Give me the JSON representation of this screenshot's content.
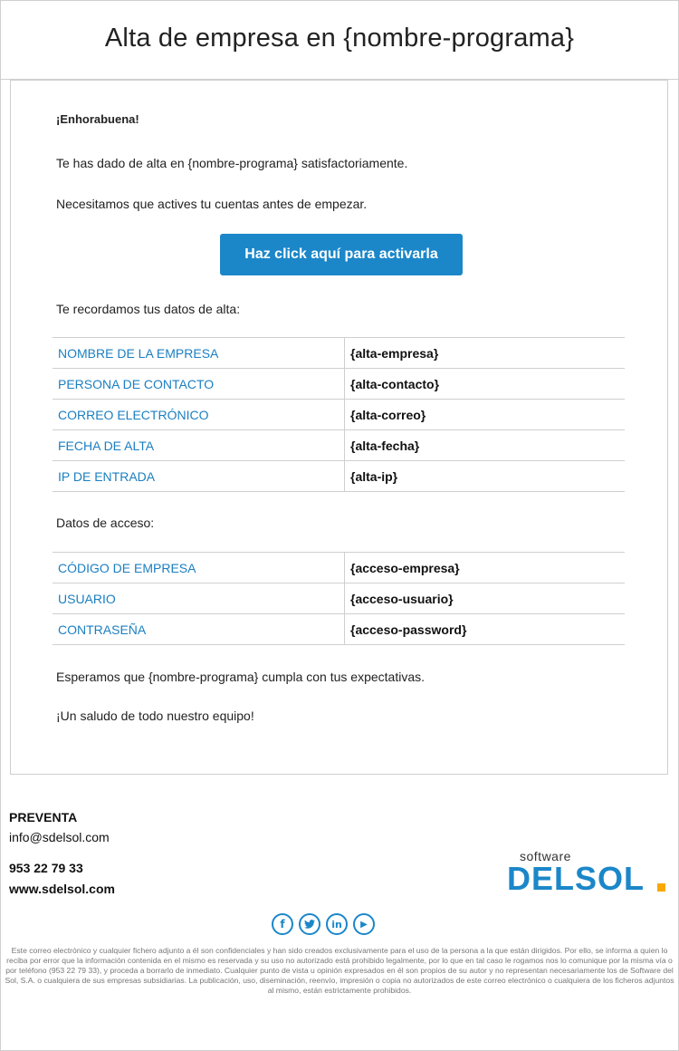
{
  "title": "Alta de empresa en {nombre-programa}",
  "greeting": "¡Enhorabuena!",
  "line1": "Te has dado de alta en {nombre-programa} satisfactoriamente.",
  "line2": "Necesitamos que actives tu cuentas antes de empezar.",
  "button_label": "Haz click aquí para activarla",
  "reminder": "Te recordamos tus datos de alta:",
  "alta_rows": [
    {
      "label": "NOMBRE DE LA EMPRESA",
      "value": "{alta-empresa}"
    },
    {
      "label": "PERSONA DE CONTACTO",
      "value": "{alta-contacto}"
    },
    {
      "label": "CORREO ELECTRÓNICO",
      "value": "{alta-correo}"
    },
    {
      "label": "FECHA DE ALTA",
      "value": "{alta-fecha}"
    },
    {
      "label": "IP DE ENTRADA",
      "value": "{alta-ip}"
    }
  ],
  "access_title": "Datos de acceso:",
  "access_rows": [
    {
      "label": "CÓDIGO DE EMPRESA",
      "value": "{acceso-empresa}"
    },
    {
      "label": "USUARIO",
      "value": "{acceso-usuario}"
    },
    {
      "label": "CONTRASEÑA",
      "value": "{acceso-password}"
    }
  ],
  "closing1": "Esperamos que {nombre-programa} cumpla con tus expectativas.",
  "closing2": "¡Un saludo de todo nuestro equipo!",
  "footer": {
    "heading": "PREVENTA",
    "email": "info@sdelsol.com",
    "phone": "953 22 79 33",
    "web": "www.sdelsol.com"
  },
  "logo": {
    "small": "software",
    "big": "DELSOL"
  },
  "socials": [
    {
      "name": "facebook-icon",
      "glyph": "f"
    },
    {
      "name": "twitter-icon",
      "glyph": "🐦"
    },
    {
      "name": "linkedin-icon",
      "glyph": "in"
    },
    {
      "name": "youtube-icon",
      "glyph": "▶"
    }
  ],
  "disclaimer": "Este correo electrónico y cualquier fichero adjunto a él son confidenciales y han sido creados exclusivamente para el uso de la persona a la que están dirigidos. Por ello, se informa a quien lo reciba por error que la información contenida en el mismo es reservada y su uso no autorizado está prohibido legalmente, por lo que en tal caso le rogamos nos lo comunique por la misma vía o por teléfono (953 22 79 33), y proceda a borrarlo de inmediato. Cualquier punto de vista u opinión expresados en él son propios de su autor y no representan necesariamente los de Software del Sol, S.A. o cualquiera de sus empresas subsidiarias. La publicación, uso, diseminación, reenvío, impresión o copia no autorizados de este correo electrónico o cualquiera de los ficheros adjuntos al mismo, están estrictamente prohibidos.",
  "colors": {
    "accent": "#1b87c9",
    "logo_dot": "#f7a900"
  }
}
